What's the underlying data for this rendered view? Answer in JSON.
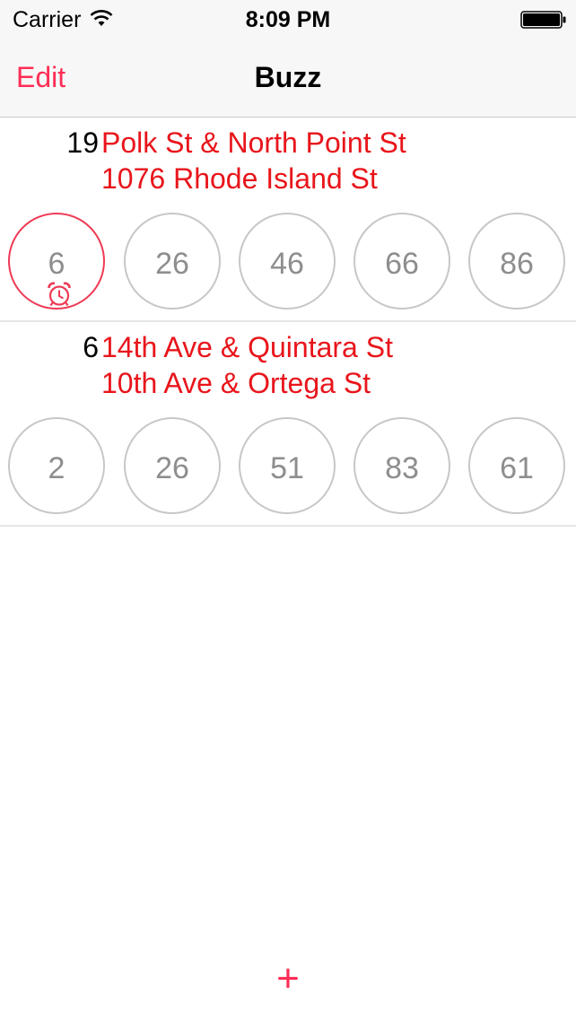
{
  "status_bar": {
    "carrier": "Carrier",
    "time": "8:09 PM",
    "wifi_icon": "wifi-icon",
    "battery_icon": "battery-icon"
  },
  "nav": {
    "edit_label": "Edit",
    "title": "Buzz"
  },
  "stops": [
    {
      "route": "19",
      "line1": "Polk St & North Point St",
      "line2": "1076 Rhode Island St",
      "times": [
        "6",
        "26",
        "46",
        "66",
        "86"
      ],
      "alarm_on_first": true,
      "alarm_icon": "alarm-clock-icon"
    },
    {
      "route": "6",
      "line1": "14th Ave & Quintara St",
      "line2": "10th Ave & Ortega St",
      "times": [
        "2",
        "26",
        "51",
        "83",
        "61"
      ],
      "alarm_on_first": false
    }
  ],
  "toolbar": {
    "add_label": "+"
  },
  "colors": {
    "accent": "#ff2d55",
    "stop_text": "#e8151b",
    "alarm_ring": "#ee3a55",
    "circle_border": "#c7c7c7",
    "time_text": "#8e8e8e"
  }
}
